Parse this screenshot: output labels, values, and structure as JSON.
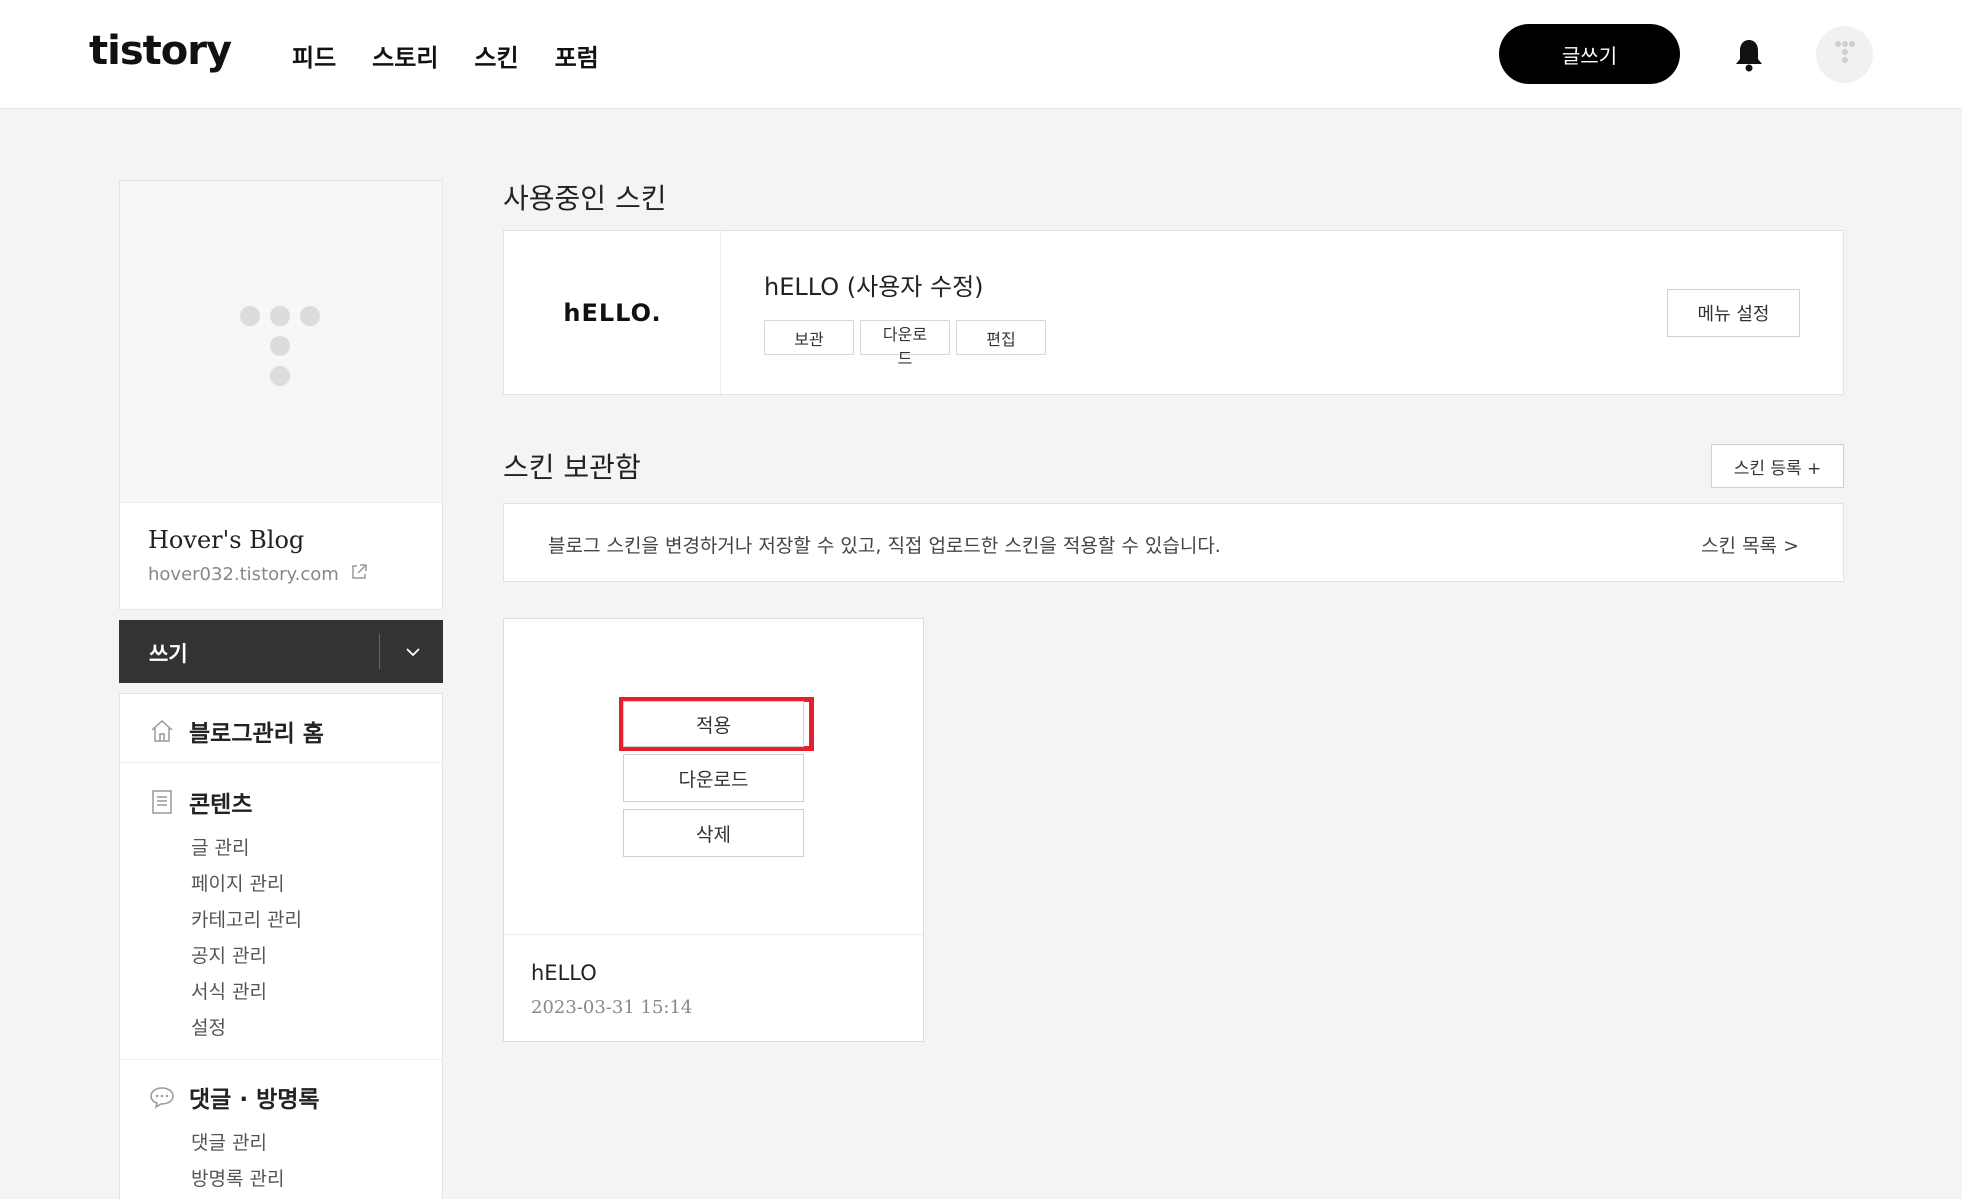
{
  "header": {
    "logo": "tistory",
    "nav": [
      "피드",
      "스토리",
      "스킨",
      "포럼"
    ],
    "write_button": "글쓰기",
    "icons": [
      "bell-icon",
      "profile-avatar"
    ]
  },
  "sidebar": {
    "blog_name": "Hover's Blog",
    "blog_url": "hover032.tistory.com",
    "write_label": "쓰기",
    "menu": {
      "home": "블로그관리 홈",
      "contents": {
        "title": "콘텐츠",
        "items": [
          "글 관리",
          "페이지 관리",
          "카테고리 관리",
          "공지 관리",
          "서식 관리",
          "설정"
        ]
      },
      "comments": {
        "title": "댓글 · 방명록",
        "items": [
          "댓글 관리",
          "방명록 관리"
        ]
      }
    }
  },
  "current_skin": {
    "section_title": "사용중인 스킨",
    "thumb_text": "hELLO.",
    "name": "hELLO (사용자 수정)",
    "buttons": [
      "보관",
      "다운로드",
      "편집"
    ],
    "menu_setting": "메뉴 설정"
  },
  "skin_storage": {
    "section_title": "스킨 보관함",
    "register_button": "스킨 등록 +",
    "info_text": "블로그 스킨을 변경하거나 저장할 수 있고, 직접 업로드한 스킨을 적용할 수 있습니다.",
    "list_link": "스킨 목록 >",
    "card": {
      "apply": "적용",
      "download": "다운로드",
      "delete": "삭제",
      "name": "hELLO",
      "date": "2023-03-31 15:14"
    }
  },
  "colors": {
    "accent_highlight": "#e3202b",
    "write_bar": "#333333",
    "page_bg": "#f3f4f6"
  }
}
